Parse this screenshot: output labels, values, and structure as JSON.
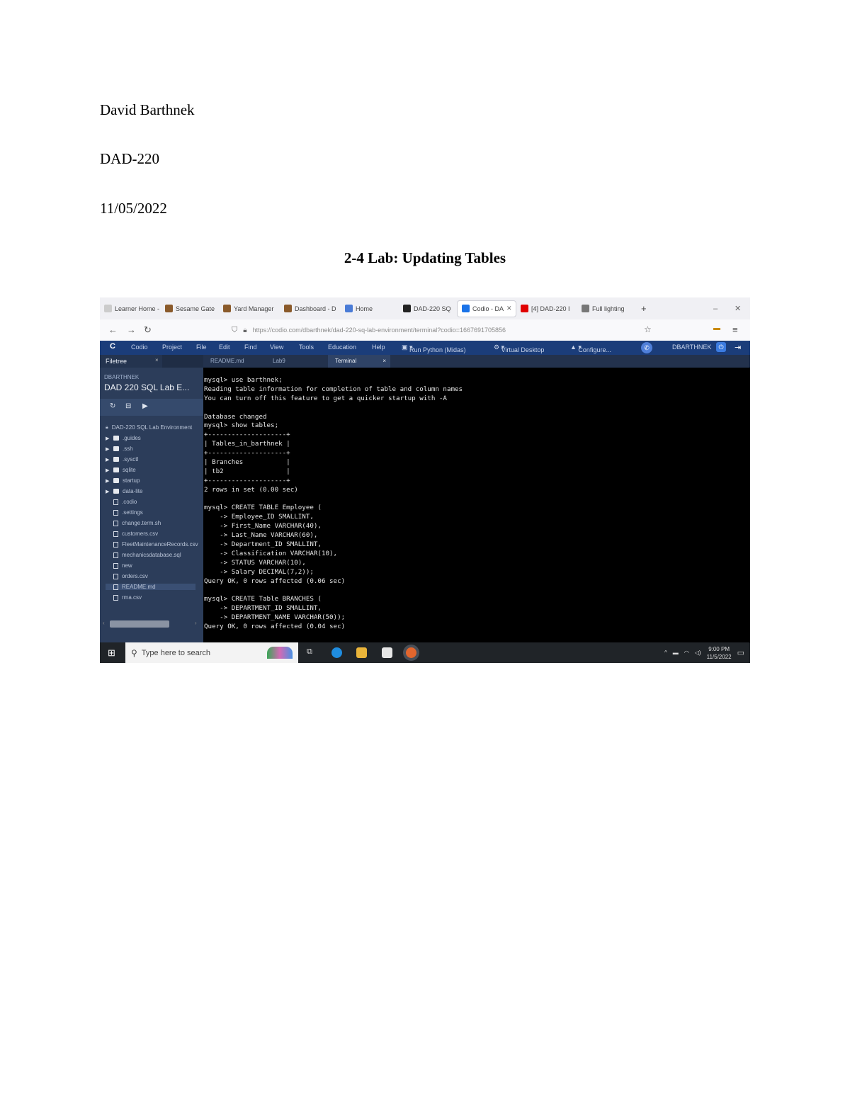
{
  "doc": {
    "author": "David Barthnek",
    "course": "DAD-220",
    "date": "11/05/2022",
    "title": "2-4 Lab: Updating Tables"
  },
  "browser": {
    "tabs": [
      {
        "label": "Learner Home - P",
        "icon_color": "#cccccc"
      },
      {
        "label": "Sesame Gate",
        "icon_color": "#8a5a2b"
      },
      {
        "label": "Yard Manager",
        "icon_color": "#8a5a2b"
      },
      {
        "label": "Dashboard - D",
        "icon_color": "#8a5a2b"
      },
      {
        "label": "Home",
        "icon_color": "#4a7bd6"
      },
      {
        "label": "DAD-220 SQ",
        "icon_color": "#222222"
      },
      {
        "label": "Codio - DA",
        "icon_color": "#1a73e8",
        "active": true
      },
      {
        "label": "[4] DAD-220 I",
        "icon_color": "#e00000"
      },
      {
        "label": "Full lighting",
        "icon_color": "#777777"
      }
    ],
    "new_tab": "+",
    "url": "https://codio.com/dbarthnek/dad-220-sq-lab-environment/terminal?codio=1667691705856"
  },
  "codio": {
    "menu": [
      "Codio",
      "Project",
      "File",
      "Edit",
      "Find",
      "View",
      "Tools",
      "Education",
      "Help"
    ],
    "run_label": "Run Python (Midas)",
    "vd_label": "Virtual Desktop",
    "config_label": "Configure...",
    "user": "DBARTHNEK",
    "sidebar_tab": "Filetree",
    "owner": "DBARTHNEK",
    "project": "DAD 220 SQL Lab E...",
    "root": "DAD-220 SQL Lab Environment",
    "folders": [
      ".guides",
      ".ssh",
      ".sysctl",
      "sqlite",
      "startup",
      "data-lite"
    ],
    "files": [
      ".codio",
      ".settings",
      "change.term.sh",
      "customers.csv",
      "FleetMaintenanceRecords.csv",
      "mechanicsdatabase.sql",
      "new",
      "orders.csv",
      "README.md",
      "rma.csv"
    ],
    "editor_tabs": [
      "README.md",
      "Lab9",
      "Terminal"
    ],
    "terminal_lines": [
      "mysql> use barthnek;",
      "Reading table information for completion of table and column names",
      "You can turn off this feature to get a quicker startup with -A",
      "",
      "Database changed",
      "mysql> show tables;",
      "+--------------------+",
      "| Tables_in_barthnek |",
      "+--------------------+",
      "| Branches           |",
      "| tb2                |",
      "+--------------------+",
      "2 rows in set (0.00 sec)",
      "",
      "mysql> CREATE TABLE Employee (",
      "    -> Employee_ID SMALLINT,",
      "    -> First_Name VARCHAR(40),",
      "    -> Last_Name VARCHAR(60),",
      "    -> Department_ID SMALLINT,",
      "    -> Classification VARCHAR(10),",
      "    -> STATUS VARCHAR(10),",
      "    -> Salary DECIMAL(7,2));",
      "Query OK, 0 rows affected (0.06 sec)",
      "",
      "mysql> CREATE Table BRANCHES (",
      "    -> DEPARTMENT_ID SMALLINT,",
      "    -> DEPARTMENT_NAME VARCHAR(50));",
      "Query OK, 0 rows affected (0.04 sec)"
    ]
  },
  "taskbar": {
    "search_placeholder": "Type here to search",
    "time": "9:00 PM",
    "date": "11/5/2022"
  }
}
